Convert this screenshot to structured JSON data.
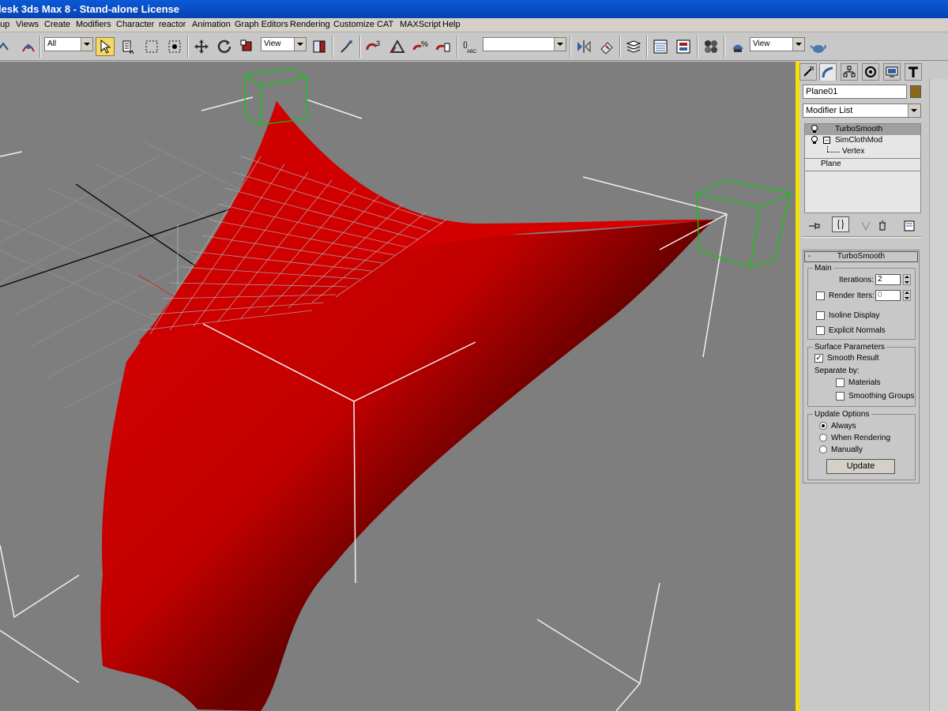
{
  "window": {
    "title": "lesk 3ds Max 8  - Stand-alone License"
  },
  "menu": {
    "items": [
      "up",
      "Views",
      "Create",
      "Modifiers",
      "Character",
      "reactor",
      "Animation",
      "Graph Editors",
      "Rendering",
      "Customize",
      "CAT",
      "MAXScript",
      "Help"
    ]
  },
  "toolbar": {
    "selection_filter": "All",
    "coord_system": "View",
    "named_selection": "",
    "render_view": "View"
  },
  "command_panel": {
    "object_name": "Plane01",
    "object_color": "#8a6a16",
    "modifier_list_label": "Modifier List",
    "stack": {
      "turbosmooth": "TurboSmooth",
      "simclothmod": "SimClothMod",
      "vertex": "Vertex",
      "plane": "Plane"
    }
  },
  "rollout": {
    "title": "TurboSmooth",
    "collapse_symbol": "-",
    "main": {
      "label": "Main",
      "iterations_label": "Iterations:",
      "iterations_value": "2",
      "render_iters_label": "Render Iters:",
      "render_iters_value": "0",
      "isoline_label": "Isoline Display",
      "explicit_normals_label": "Explicit Normals"
    },
    "surface": {
      "label": "Surface Parameters",
      "smooth_result_label": "Smooth Result",
      "separate_by_label": "Separate by:",
      "materials_label": "Materials",
      "smoothing_groups_label": "Smoothing Groups"
    },
    "update_options": {
      "label": "Update Options",
      "always_label": "Always",
      "when_rendering_label": "When Rendering",
      "manually_label": "Manually",
      "update_button": "Update"
    }
  },
  "colors": {
    "viewport_bg": "#7e7e7e",
    "cloth": "#d00000",
    "selection_box": "#00cc00",
    "active_viewport_border": "#f4e200"
  }
}
